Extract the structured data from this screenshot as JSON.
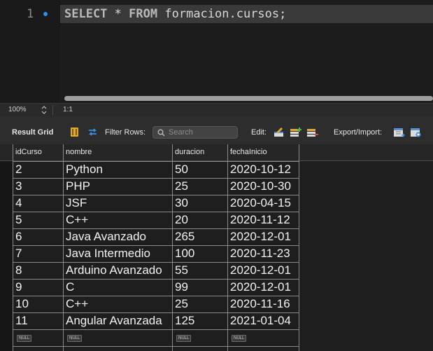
{
  "editor": {
    "line_number": "1",
    "query_keyword_select": "SELECT",
    "query_star": "*",
    "query_keyword_from": "FROM",
    "query_table": "formacion.cursos;"
  },
  "status": {
    "zoom": "100%",
    "ratio": "1:1"
  },
  "toolbar": {
    "result_grid": "Result Grid",
    "filter_rows": "Filter Rows:",
    "search_placeholder": "Search",
    "edit": "Edit:",
    "export_import": "Export/Import:"
  },
  "grid": {
    "columns": [
      "idCurso",
      "nombre",
      "duracion",
      "fechaInicio"
    ],
    "rows": [
      [
        "2",
        "Python",
        "50",
        "2020-10-12"
      ],
      [
        "3",
        "PHP",
        "25",
        "2020-10-30"
      ],
      [
        "4",
        "JSF",
        "30",
        "2020-04-15"
      ],
      [
        "5",
        "C++",
        "20",
        "2020-11-12"
      ],
      [
        "6",
        "Java Avanzado",
        "265",
        "2020-12-01"
      ],
      [
        "7",
        "Java Intermedio",
        "100",
        "2020-11-23"
      ],
      [
        "8",
        "Arduino Avanzado",
        "55",
        "2020-12-01"
      ],
      [
        "9",
        "C",
        "99",
        "2020-12-01"
      ],
      [
        "10",
        "C++",
        "25",
        "2020-11-16"
      ],
      [
        "11",
        "Angular Avanzada",
        "125",
        "2021-01-04"
      ]
    ],
    "new_row": [
      "NULL",
      "NULL",
      "NULL",
      "NULL"
    ]
  },
  "icons": {
    "form-editor": "form-editor-icon",
    "wrap": "wrap-cell-content-icon",
    "search": "search-icon",
    "edit-current-row": "edit-current-row-icon",
    "insert-row": "insert-row-icon",
    "delete-row": "delete-row-icon",
    "export": "export-icon",
    "import": "import-icon"
  },
  "colors": {
    "line_marker": "#2f8ef0",
    "wrap_icon": "#3c8ee8",
    "form_icon": "#e2a930"
  }
}
